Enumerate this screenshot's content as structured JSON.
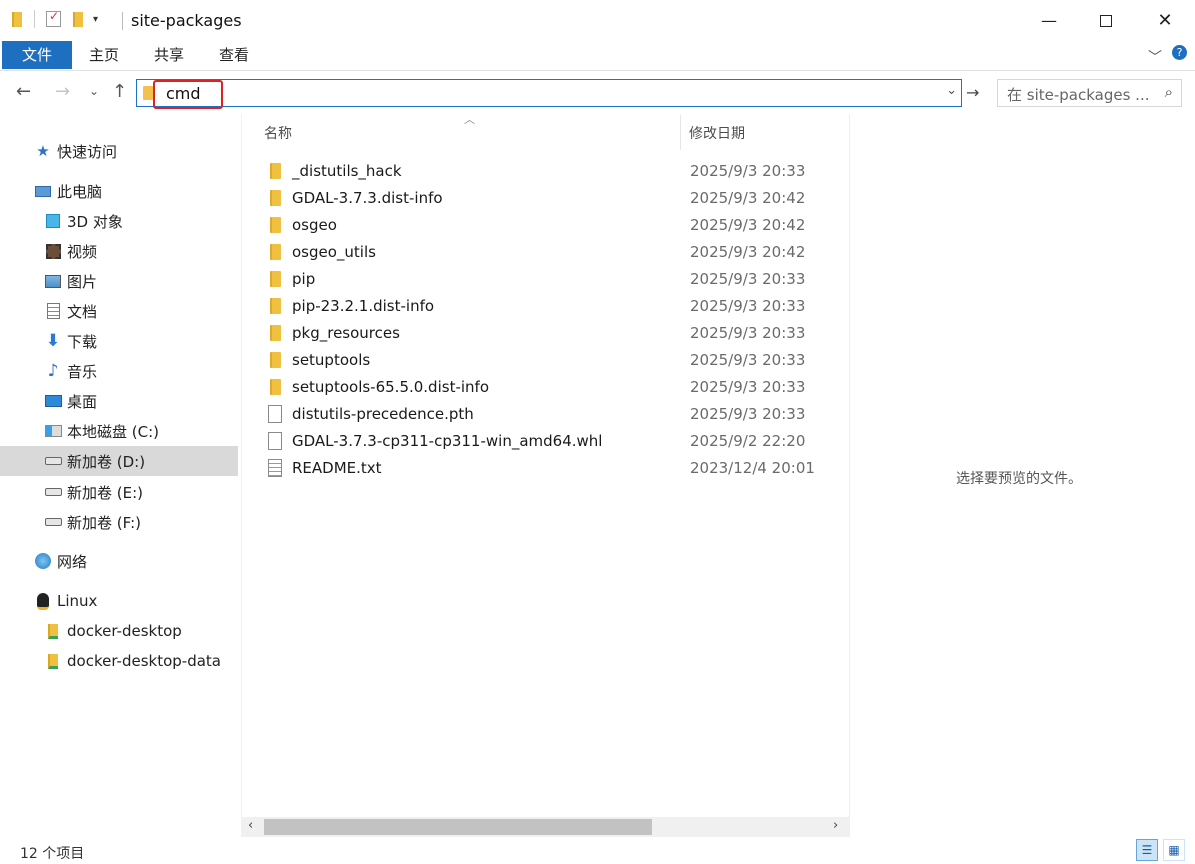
{
  "window": {
    "title": "site-packages",
    "minimize_icon": "minimize-icon",
    "maximize_icon": "maximize-icon",
    "close_icon": "close-icon"
  },
  "ribbon": {
    "tabs": [
      "文件",
      "主页",
      "共享",
      "查看"
    ]
  },
  "address": {
    "value": "cmd",
    "search_placeholder": "在 site-packages ..."
  },
  "nav": {
    "items": [
      {
        "label": "快速访问",
        "icon": "star-icon"
      },
      {
        "label": "此电脑",
        "icon": "computer-icon"
      },
      {
        "label": "3D 对象",
        "icon": "cube-icon"
      },
      {
        "label": "视频",
        "icon": "video-icon"
      },
      {
        "label": "图片",
        "icon": "picture-icon"
      },
      {
        "label": "文档",
        "icon": "document-icon"
      },
      {
        "label": "下载",
        "icon": "download-icon"
      },
      {
        "label": "音乐",
        "icon": "music-icon"
      },
      {
        "label": "桌面",
        "icon": "desktop-icon"
      },
      {
        "label": "本地磁盘 (C:)",
        "icon": "drive-windows-icon"
      },
      {
        "label": "新加卷 (D:)",
        "icon": "drive-icon",
        "selected": true
      },
      {
        "label": "新加卷 (E:)",
        "icon": "drive-icon"
      },
      {
        "label": "新加卷 (F:)",
        "icon": "drive-icon"
      },
      {
        "label": "网络",
        "icon": "network-icon"
      },
      {
        "label": "Linux",
        "icon": "penguin-icon"
      },
      {
        "label": "docker-desktop",
        "icon": "network-folder-icon"
      },
      {
        "label": "docker-desktop-data",
        "icon": "network-folder-icon"
      }
    ]
  },
  "filelist": {
    "col_name": "名称",
    "col_date": "修改日期",
    "rows": [
      {
        "name": "_distutils_hack",
        "date": "2025/9/3 20:33",
        "type": "folder"
      },
      {
        "name": "GDAL-3.7.3.dist-info",
        "date": "2025/9/3 20:42",
        "type": "folder"
      },
      {
        "name": "osgeo",
        "date": "2025/9/3 20:42",
        "type": "folder"
      },
      {
        "name": "osgeo_utils",
        "date": "2025/9/3 20:42",
        "type": "folder"
      },
      {
        "name": "pip",
        "date": "2025/9/3 20:33",
        "type": "folder"
      },
      {
        "name": "pip-23.2.1.dist-info",
        "date": "2025/9/3 20:33",
        "type": "folder"
      },
      {
        "name": "pkg_resources",
        "date": "2025/9/3 20:33",
        "type": "folder"
      },
      {
        "name": "setuptools",
        "date": "2025/9/3 20:33",
        "type": "folder"
      },
      {
        "name": "setuptools-65.5.0.dist-info",
        "date": "2025/9/3 20:33",
        "type": "folder"
      },
      {
        "name": "distutils-precedence.pth",
        "date": "2025/9/3 20:33",
        "type": "file"
      },
      {
        "name": "GDAL-3.7.3-cp311-cp311-win_amd64.whl",
        "date": "2025/9/2 22:20",
        "type": "file"
      },
      {
        "name": "README.txt",
        "date": "2023/12/4 20:01",
        "type": "text"
      }
    ]
  },
  "preview": {
    "message": "选择要预览的文件。"
  },
  "status": {
    "count": "12 个项目"
  },
  "colors": {
    "accent": "#1f6fc1",
    "highlight_box": "#e02222",
    "folder": "#f0c040",
    "selection": "#d9d9d9"
  }
}
